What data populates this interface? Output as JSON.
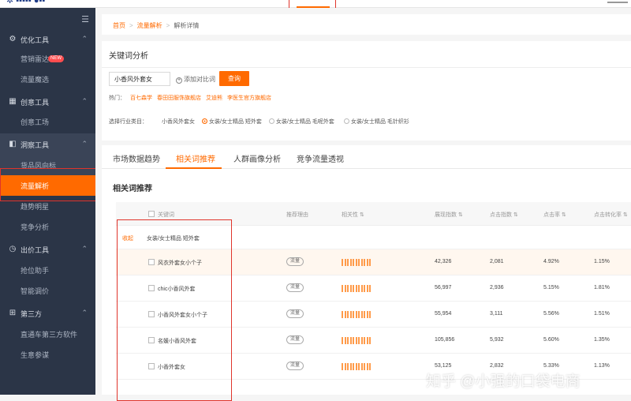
{
  "breadcrumb": {
    "items": [
      "首页",
      "流量解析",
      "解析详情"
    ]
  },
  "sidebar": {
    "groups": [
      {
        "label": "优化工具",
        "items": [
          {
            "label": "营销雷达",
            "badge": "NEW"
          },
          {
            "label": "流量魔选"
          }
        ]
      },
      {
        "label": "创意工具",
        "items": [
          {
            "label": "创意工场"
          }
        ]
      },
      {
        "label": "洞察工具",
        "items": [
          {
            "label": "货品风向标"
          },
          {
            "label": "流量解析",
            "active": true
          },
          {
            "label": "趋势明星"
          },
          {
            "label": "竞争分析"
          }
        ]
      },
      {
        "label": "出价工具",
        "items": [
          {
            "label": "抢位助手"
          },
          {
            "label": "智能调价"
          }
        ]
      },
      {
        "label": "第三方",
        "items": [
          {
            "label": "直通车第三方软件"
          },
          {
            "label": "生意参谋"
          }
        ]
      }
    ]
  },
  "keyword_panel": {
    "title": "关键词分析",
    "search_value": "小香风外套女",
    "add_compare_label": "添加对比词",
    "query_button": "查询",
    "hot_label": "热门：",
    "hot_links": [
      "百七森学",
      "春田田服饰旗舰店",
      "艾迪熊",
      "李医生官方旗舰店"
    ],
    "category_label": "选择行业类目：",
    "category_keyword": "小香风外套女",
    "category_options": [
      {
        "label": "女装/女士精品 短外套",
        "selected": true
      },
      {
        "label": "女装/女士精品 毛呢外套",
        "selected": false
      },
      {
        "label": "女装/女士精品 毛针织衫",
        "selected": false
      }
    ]
  },
  "tabs": [
    {
      "label": "市场数据趋势",
      "active": false
    },
    {
      "label": "相关词推荐",
      "active": true
    },
    {
      "label": "人群画像分析",
      "active": false
    },
    {
      "label": "竞争流量透视",
      "active": false
    }
  ],
  "section_title": "相关词推荐",
  "table": {
    "headers": {
      "keyword": "关键词",
      "reason": "推荐理由",
      "relevance": "相关性 ⇅",
      "search_index": "展现指数 ⇅",
      "click_index": "点击指数 ⇅",
      "ctr": "点击率 ⇅",
      "cvr": "点击转化率 ⇅"
    },
    "group": {
      "collapse_label": "收起",
      "name": "女装/女士精品 短外套"
    },
    "rows": [
      {
        "keyword": "风衣外套女小个子",
        "tag": "流量",
        "search": "42,326",
        "click": "2,081",
        "ctr": "4.92%",
        "cvr": "1.15%"
      },
      {
        "keyword": "chic小香风外套",
        "tag": "流量",
        "search": "56,997",
        "click": "2,936",
        "ctr": "5.15%",
        "cvr": "1.81%"
      },
      {
        "keyword": "小香风外套女小个子",
        "tag": "流量",
        "search": "55,954",
        "click": "3,111",
        "ctr": "5.56%",
        "cvr": "1.51%"
      },
      {
        "keyword": "名媛小香风外套",
        "tag": "流量",
        "search": "105,856",
        "click": "5,932",
        "ctr": "5.60%",
        "cvr": "1.35%"
      },
      {
        "keyword": "小香外套女",
        "tag": "流量",
        "search": "53,125",
        "click": "2,832",
        "ctr": "5.33%",
        "cvr": "1.13%"
      }
    ]
  },
  "watermark": "知乎 @小强的口袋电商",
  "colors": {
    "accent": "#ff6a00",
    "sidebar": "#2b3547",
    "highlight_box": "#e0342b"
  }
}
